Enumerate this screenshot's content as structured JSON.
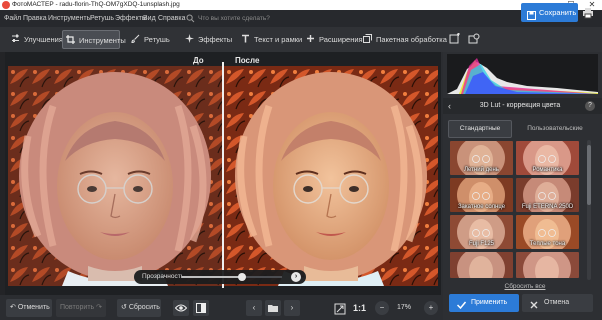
{
  "window": {
    "title": "ФотоМАСТЕР - radu-florin-ThQ-OM7gXDQ-1unsplash.jpg",
    "controls": [
      "—",
      "☐",
      "✕"
    ]
  },
  "menu": {
    "items": [
      "Файл",
      "Правка",
      "Инструменты",
      "Ретушь",
      "Эффекты",
      "Вид",
      "Справка"
    ],
    "search_placeholder": "Что вы хотите сделать?"
  },
  "toolbar": {
    "tabs": [
      {
        "label": "Улучшения",
        "icon": "sliders-icon"
      },
      {
        "label": "Инструменты",
        "icon": "crop-icon",
        "active": true
      },
      {
        "label": "Ретушь",
        "icon": "brush-icon"
      },
      {
        "label": "Эффекты",
        "icon": "sparkle-icon"
      },
      {
        "label": "Текст и рамки",
        "icon": "text-icon"
      },
      {
        "label": "Расширения",
        "icon": "plus-icon"
      },
      {
        "label": "Пакетная обработка",
        "icon": "batch-icon"
      }
    ],
    "save_label": "Сохранить"
  },
  "canvas": {
    "before_label": "До",
    "after_label": "После",
    "opacity_label": "Прозрачность",
    "opacity": 0.6
  },
  "bottombar": {
    "undo_label": "Отменить",
    "redo_label": "Повторить",
    "reset_label": "Сбросить",
    "ratio_label": "1:1",
    "zoom_value": "17%"
  },
  "panel": {
    "title": "3D Lut - коррекция цвета",
    "tab_standard": "Стандартные",
    "tab_professional": "Пользовательские",
    "presets": [
      {
        "name": "Летний день"
      },
      {
        "name": "Романтика"
      },
      {
        "name": "Закатное солнце"
      },
      {
        "name": "Fuji ETERNA 250D"
      },
      {
        "name": "Fuji F125"
      },
      {
        "name": "Теплые тона"
      },
      {
        "name": ""
      },
      {
        "name": ""
      }
    ],
    "reset_all_label": "Сбросить все",
    "apply_label": "Применить",
    "cancel_label": "Отмена"
  },
  "colors": {
    "accent": "#2c7bd7",
    "background": "#2b2d31",
    "panel": "#2d2f33"
  }
}
